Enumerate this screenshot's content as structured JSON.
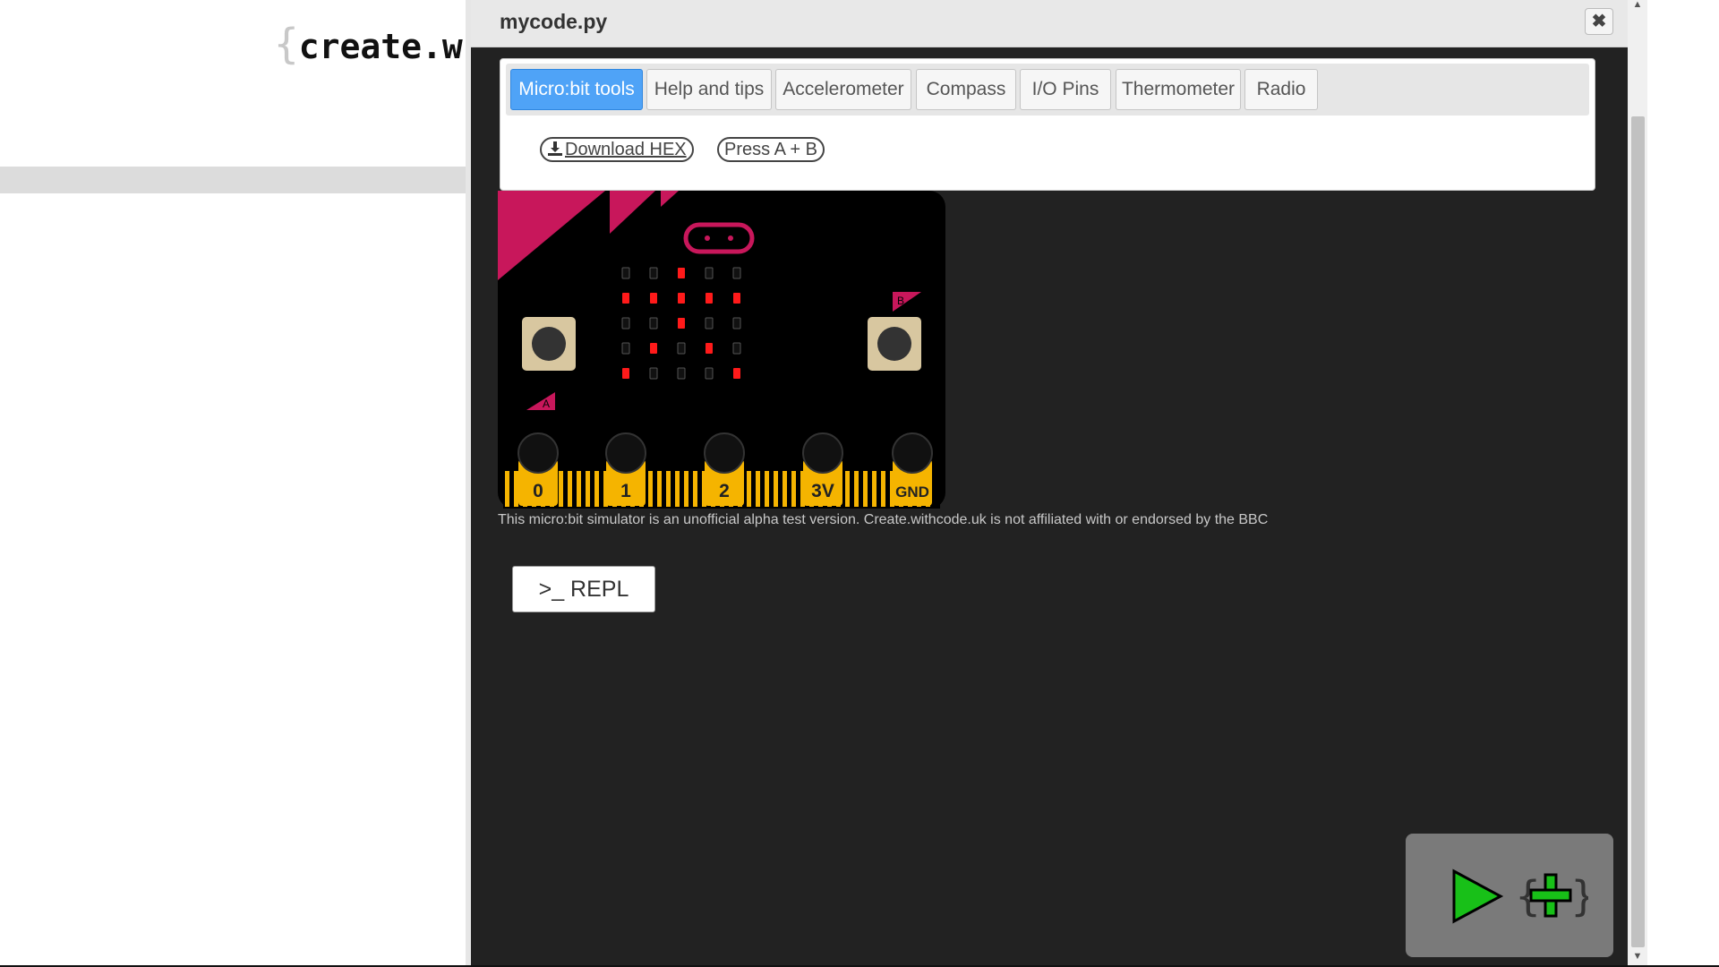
{
  "page": {
    "logo_brace": "{",
    "logo_text": "create.w"
  },
  "dialog": {
    "title": "mycode.py",
    "close_glyph": "✖",
    "tabs": [
      {
        "label": "Micro:bit tools",
        "active": true
      },
      {
        "label": "Help and tips",
        "active": false
      },
      {
        "label": "Accelerometer",
        "active": false
      },
      {
        "label": "Compass",
        "active": false
      },
      {
        "label": "I/O Pins",
        "active": false
      },
      {
        "label": "Thermometer",
        "active": false
      },
      {
        "label": "Radio",
        "active": false
      }
    ],
    "download_hex_label": "Download HEX",
    "press_ab_label": "Press A + B",
    "disclaimer": "This micro:bit simulator is an unofficial alpha test version. Create.withcode.uk is not affiliated with or endorsed by the BBC",
    "repl_label": ">_ REPL"
  },
  "microbit": {
    "led_matrix": [
      [
        0,
        0,
        1,
        0,
        0
      ],
      [
        1,
        1,
        1,
        1,
        1
      ],
      [
        0,
        0,
        1,
        0,
        0
      ],
      [
        0,
        1,
        0,
        1,
        0
      ],
      [
        1,
        0,
        0,
        0,
        1
      ]
    ],
    "button_a_label": "A",
    "button_b_label": "B",
    "pins": [
      "0",
      "1",
      "2",
      "3V",
      "GND"
    ],
    "board_color": "#000000",
    "accent_color": "#c8175b",
    "pin_color": "#f5b400",
    "led_on_color": "#ff1a1a"
  },
  "icons": {
    "run": "play-triangle-icon",
    "add": "plus-braces-icon",
    "download": "download-icon",
    "close": "close-icon"
  }
}
